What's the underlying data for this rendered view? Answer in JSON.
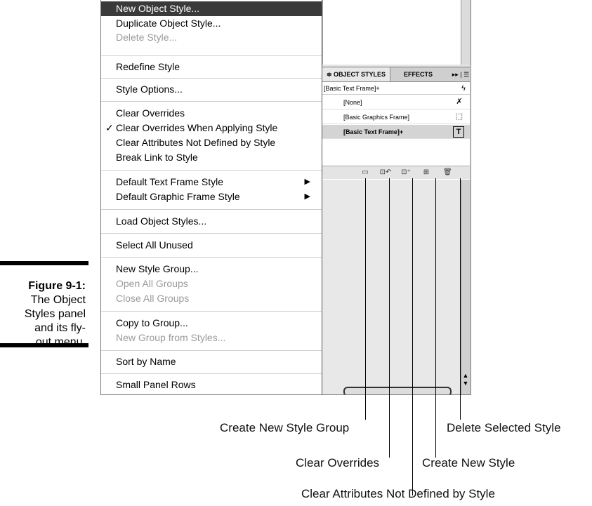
{
  "caption": {
    "figure_label": "Figure 9-1:",
    "text_lines": [
      "The Object",
      "Styles panel",
      "and its fly-",
      "out menu."
    ]
  },
  "menu": {
    "items": [
      {
        "label": "New Object Style...",
        "state": "highlighted"
      },
      {
        "label": "Duplicate Object Style...",
        "state": "enabled"
      },
      {
        "label": "Delete Style...",
        "state": "disabled"
      },
      {
        "label": "Redefine Style",
        "state": "enabled"
      },
      {
        "label": "Style Options...",
        "state": "enabled"
      },
      {
        "label": "Clear Overrides",
        "state": "enabled"
      },
      {
        "label": "Clear Overrides When Applying Style",
        "state": "checked",
        "check": "✓"
      },
      {
        "label": "Clear Attributes Not Defined by Style",
        "state": "enabled"
      },
      {
        "label": "Break Link to Style",
        "state": "enabled"
      },
      {
        "label": "Default Text Frame Style",
        "state": "submenu",
        "arrow": "▶"
      },
      {
        "label": "Default Graphic Frame Style",
        "state": "submenu",
        "arrow": "▶"
      },
      {
        "label": "Load Object Styles...",
        "state": "enabled"
      },
      {
        "label": "Select All Unused",
        "state": "enabled"
      },
      {
        "label": "New Style Group...",
        "state": "enabled"
      },
      {
        "label": "Open All Groups",
        "state": "disabled"
      },
      {
        "label": "Close All Groups",
        "state": "disabled"
      },
      {
        "label": "Copy to Group...",
        "state": "enabled"
      },
      {
        "label": "New Group from Styles...",
        "state": "disabled"
      },
      {
        "label": "Sort by Name",
        "state": "enabled"
      },
      {
        "label": "Small Panel Rows",
        "state": "enabled"
      }
    ]
  },
  "panel": {
    "tab_active": "≑ OBJECT STYLES",
    "tab_other": "EFFECTS",
    "tab_menu": "▸▸ | ☰",
    "current_style": "[Basic Text Frame]+",
    "current_style_icon": "ϟ",
    "styles": [
      {
        "name": "[None]",
        "icon": "✗",
        "icon_name": "none-style-icon"
      },
      {
        "name": "[Basic Graphics Frame]",
        "icon": "⬚",
        "icon_name": "graphics-frame-icon"
      },
      {
        "name": "[Basic Text Frame]+",
        "icon": "T",
        "icon_name": "text-frame-icon",
        "selected": true
      }
    ],
    "footer_buttons": [
      {
        "name": "create-new-style-group-icon",
        "glyph": "▭"
      },
      {
        "name": "clear-overrides-icon",
        "glyph": "⊡↶"
      },
      {
        "name": "clear-attributes-icon",
        "glyph": "⊡⁺"
      },
      {
        "name": "create-new-style-icon",
        "glyph": "⊞"
      },
      {
        "name": "delete-style-icon",
        "glyph": "🗑"
      }
    ]
  },
  "callouts": {
    "create_new_style_group": "Create New Style Group",
    "delete_selected_style": "Delete Selected Style",
    "clear_overrides": "Clear Overrides",
    "create_new_style": "Create New Style",
    "clear_attributes": "Clear Attributes Not Defined by Style"
  }
}
